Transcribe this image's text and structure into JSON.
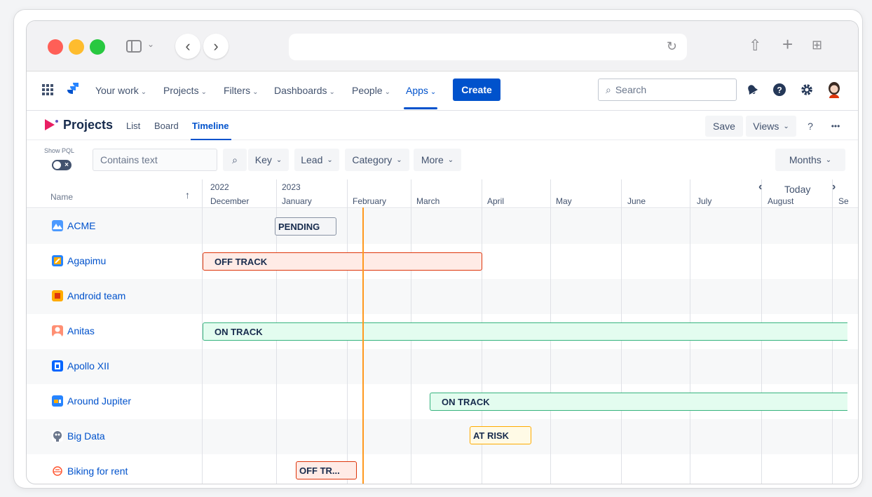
{
  "browser": {
    "colors": {
      "close": "#ff5f57",
      "minimize": "#febc2e",
      "maximize": "#28c840"
    },
    "url": ""
  },
  "topnav": {
    "items": [
      {
        "label": "Your work"
      },
      {
        "label": "Projects"
      },
      {
        "label": "Filters"
      },
      {
        "label": "Dashboards"
      },
      {
        "label": "People"
      },
      {
        "label": "Apps"
      }
    ],
    "create_label": "Create",
    "search_placeholder": "Search",
    "icons": [
      "app-switcher-icon",
      "jira-logo-icon",
      "notifications-icon",
      "help-icon",
      "settings-icon",
      "avatar"
    ]
  },
  "page": {
    "title": "Projects",
    "tabs": [
      {
        "label": "List"
      },
      {
        "label": "Board"
      },
      {
        "label": "Timeline",
        "active": true
      }
    ],
    "save_label": "Save",
    "views_label": "Views",
    "help_label": "?",
    "more_label": "•••"
  },
  "filters": {
    "show_pql_label": "Show PQL",
    "text_placeholder": "Contains text",
    "key_label": "Key",
    "lead_label": "Lead",
    "category_label": "Category",
    "more_label": "More",
    "months_label": "Months"
  },
  "timeline": {
    "name_header": "Name",
    "sort_icon": "↑",
    "years": [
      "2022",
      "2023"
    ],
    "months": [
      "December",
      "January",
      "February",
      "March",
      "April",
      "May",
      "June",
      "July",
      "August",
      "Se"
    ],
    "today_label": "Today",
    "prev_label": "‹",
    "next_label": "›",
    "status_colors": {
      "pending": {
        "bg": "#f4f5f7",
        "border": "#8993a4"
      },
      "off_track": {
        "bg": "#ffebe6",
        "border": "#de350b"
      },
      "on_track": {
        "bg": "#e3fcef",
        "border": "#36b37e"
      },
      "at_risk": {
        "bg": "#fffae6",
        "border": "#ffab00"
      }
    },
    "rows": [
      {
        "name": "ACME",
        "icon": "acme-icon",
        "status": "PENDING"
      },
      {
        "name": "Agapimu",
        "icon": "agapimu-icon",
        "status": "OFF TRACK"
      },
      {
        "name": "Android team",
        "icon": "android-team-icon",
        "status": ""
      },
      {
        "name": "Anitas",
        "icon": "anitas-icon",
        "status": "ON TRACK"
      },
      {
        "name": "Apollo XII",
        "icon": "apollo-icon",
        "status": ""
      },
      {
        "name": "Around Jupiter",
        "icon": "around-jupiter-icon",
        "status": "ON TRACK"
      },
      {
        "name": "Big Data",
        "icon": "big-data-icon",
        "status": "AT RISK"
      },
      {
        "name": "Biking for rent",
        "icon": "biking-icon",
        "status": "OFF TR..."
      }
    ]
  }
}
